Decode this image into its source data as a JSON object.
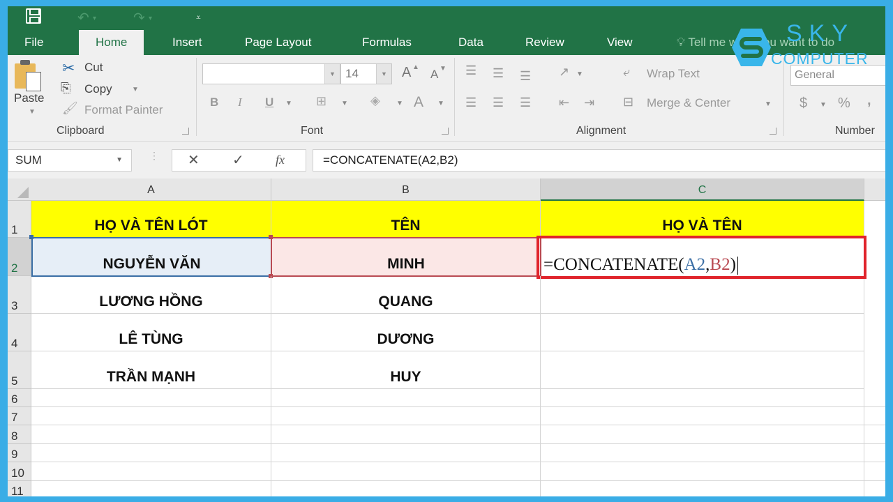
{
  "quick_access": {
    "icons": [
      "save-icon",
      "undo-icon",
      "redo-icon",
      "customize-qat-icon"
    ]
  },
  "tabs": [
    {
      "label": "File"
    },
    {
      "label": "Home",
      "active": true
    },
    {
      "label": "Insert"
    },
    {
      "label": "Page Layout"
    },
    {
      "label": "Formulas"
    },
    {
      "label": "Data"
    },
    {
      "label": "Review"
    },
    {
      "label": "View"
    }
  ],
  "tell_me": "Tell me what you want to do",
  "logo": {
    "line1": "SKY",
    "line2": "COMPUTER",
    "color": "#39b6ea"
  },
  "ribbon": {
    "clipboard": {
      "paste": "Paste",
      "cut": "Cut",
      "copy": "Copy",
      "format_painter": "Format Painter",
      "label": "Clipboard"
    },
    "font": {
      "font_name": "",
      "font_size": "14",
      "bold": "B",
      "italic": "I",
      "underline": "U",
      "font_color": "A",
      "grow": "A",
      "shrink": "A",
      "label": "Font"
    },
    "alignment": {
      "wrap_text": "Wrap Text",
      "merge_center": "Merge & Center",
      "label": "Alignment"
    },
    "number": {
      "format": "General",
      "currency": "$",
      "percent": "%",
      "comma": ",",
      "label": "Number"
    }
  },
  "formula_bar": {
    "name_box": "SUM",
    "cancel": "✕",
    "enter": "✓",
    "fx": "fx",
    "formula": "=CONCATENATE(A2,B2)"
  },
  "sheet": {
    "columns": [
      "A",
      "B",
      "C"
    ],
    "rows": [
      "1",
      "2",
      "3",
      "4",
      "5",
      "6",
      "7",
      "8",
      "9",
      "10",
      "11"
    ],
    "header_row": [
      "HỌ VÀ TÊN LÓT",
      "TÊN",
      "HỌ VÀ TÊN"
    ],
    "data": [
      [
        "NGUYỄN VĂN",
        "MINH"
      ],
      [
        "LƯƠNG HỒNG",
        "QUANG"
      ],
      [
        "LÊ TÙNG",
        "DƯƠNG"
      ],
      [
        "TRẦN MẠNH",
        "HUY"
      ]
    ],
    "editing_cell": {
      "ref": "C2",
      "prefix": "=CONCATENATE(",
      "arg1": "A2",
      "sep": ",",
      "arg2": "B2",
      "suffix": ")"
    },
    "colors": {
      "header_fill": "#ffff00",
      "ref_a": "#3a6ea5",
      "ref_b": "#b94a52",
      "highlight_box": "#e0242c",
      "excel_green": "#217346"
    }
  }
}
